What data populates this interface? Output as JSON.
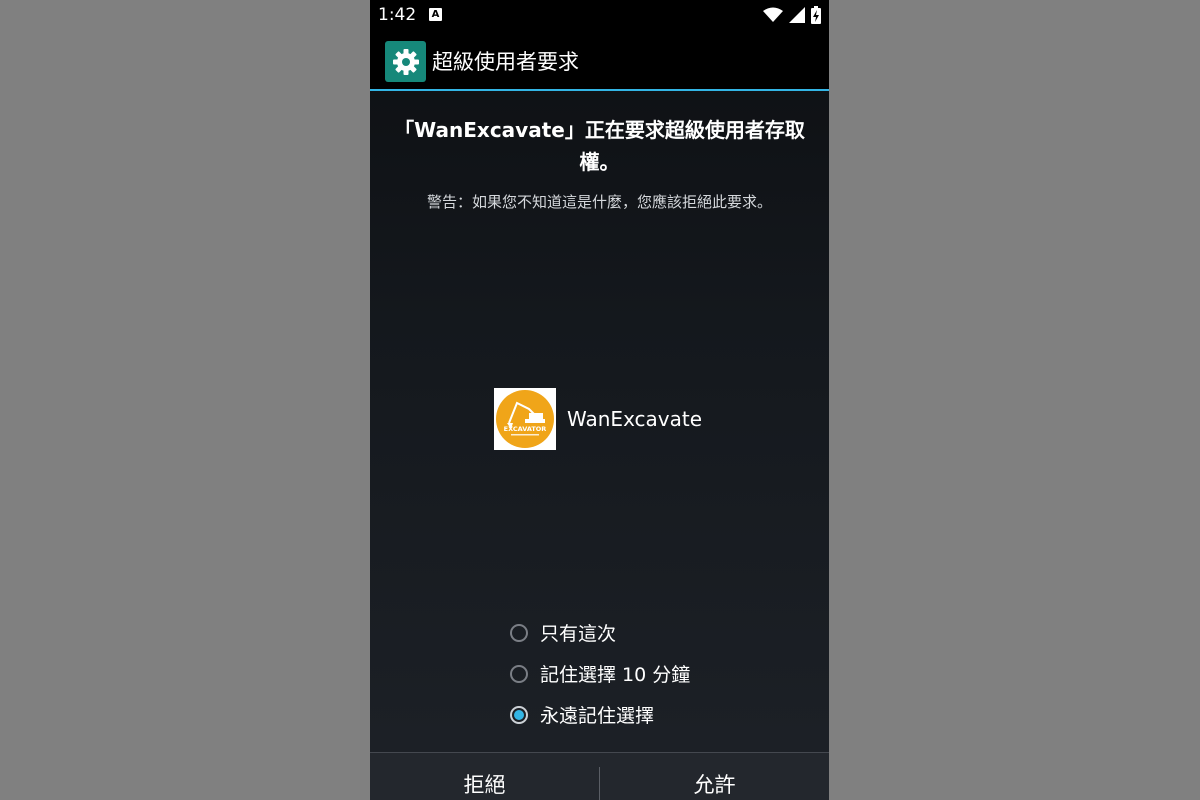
{
  "status_bar": {
    "time": "1:42",
    "notification_icon": "a-icon"
  },
  "app_bar": {
    "icon": "gear-icon",
    "title": "超級使用者要求"
  },
  "request": {
    "title": "「WanExcavate」正在要求超級使用者存取權。",
    "warning": "警告：如果您不知道這是什麼，您應該拒絕此要求。",
    "app_name": "WanExcavate",
    "app_logo_text": "EXCAVATOR"
  },
  "options": [
    {
      "label": "只有這次",
      "checked": false
    },
    {
      "label": "記住選擇 10 分鐘",
      "checked": false
    },
    {
      "label": "永遠記住選擇",
      "checked": true
    }
  ],
  "buttons": {
    "deny": "拒絕",
    "allow": "允許"
  },
  "colors": {
    "accent": "#33b5e5",
    "app_icon_bg": "#16887a",
    "logo_orange": "#f0a519"
  }
}
